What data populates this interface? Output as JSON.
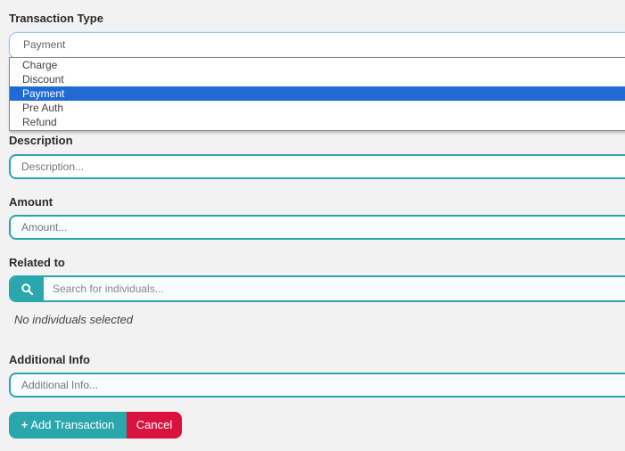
{
  "transaction_type": {
    "label": "Transaction Type",
    "selected": "Payment",
    "options": [
      "Charge",
      "Discount",
      "Payment",
      "Pre Auth",
      "Refund"
    ]
  },
  "description": {
    "label": "Description",
    "placeholder": "Description..."
  },
  "amount": {
    "label": "Amount",
    "placeholder": "Amount..."
  },
  "related_to": {
    "label": "Related to",
    "search_placeholder": "Search for individuals...",
    "empty_text": "No individuals selected"
  },
  "additional_info": {
    "label": "Additional Info",
    "placeholder": "Additional Info..."
  },
  "actions": {
    "add_label": "Add Transaction",
    "cancel_label": "Cancel"
  },
  "colors": {
    "accent": "#2aa6ad",
    "danger": "#d9123f",
    "selection": "#1f6bd3"
  },
  "icons": {
    "search": "search-icon",
    "add": "plus-icon"
  }
}
